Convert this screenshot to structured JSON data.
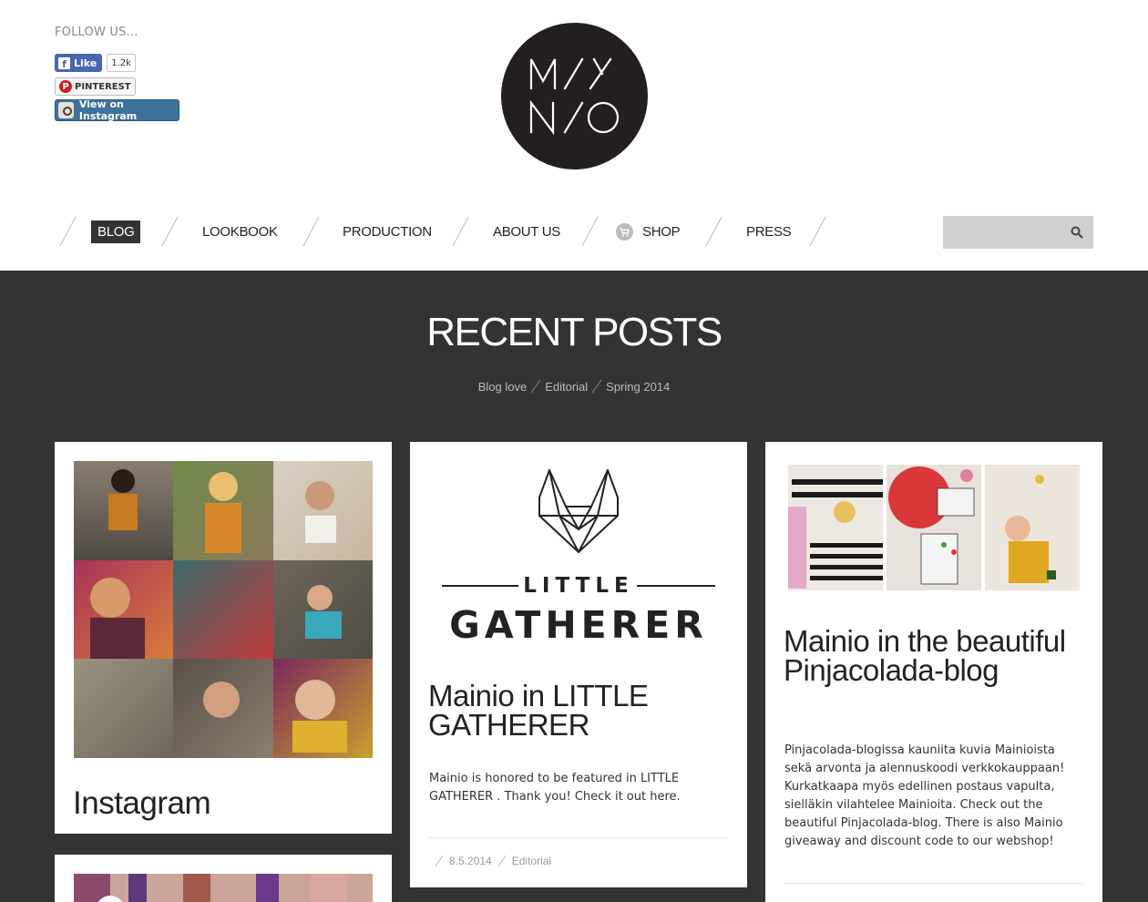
{
  "follow": {
    "title": "FOLLOW US...",
    "facebook_label": "Like",
    "facebook_count": "1.2k",
    "pinterest_label": "PINTEREST",
    "instagram_label": "View on Instagram"
  },
  "nav": {
    "items": [
      {
        "label": "BLOG",
        "active": true
      },
      {
        "label": "LOOKBOOK"
      },
      {
        "label": "PRODUCTION"
      },
      {
        "label": "ABOUT US"
      },
      {
        "label": "SHOP",
        "icon": "cart-icon"
      },
      {
        "label": "PRESS"
      }
    ],
    "search_placeholder": ""
  },
  "main": {
    "title": "RECENT POSTS",
    "filters": [
      "Blog love",
      "Editorial",
      "Spring 2014"
    ]
  },
  "posts": [
    {
      "title": "Instagram"
    },
    {
      "image_line1": "LITTLE",
      "image_line2": "GATHERER",
      "title": "Mainio in LITTLE GATHERER",
      "excerpt": "Mainio is honored to be featured in LITTLE GATHERER . Thank you! Check it out ",
      "link": "here",
      "excerpt_end": ".",
      "date": "8.5.2014",
      "category": "Editorial"
    },
    {
      "title": "Mainio in the beautiful Pinjacolada-blog",
      "excerpt": "Pinjacolada-blogissa kauniita kuvia Mainioista sekä arvonta ja alennuskoodi verkkokauppaan! Kurkatkaapa myös edellinen postaus vapulta, sielläkin vilahtelee Mainioita. Check out the beautiful Pinjacolada-blog. There is also Mainio giveaway and discount code to our webshop!"
    }
  ],
  "colors": {
    "dark": "#333333",
    "logo": "#231f20",
    "facebook": "#4a67ad",
    "pinterest": "#cb2027",
    "instagram": "#3f729b"
  }
}
